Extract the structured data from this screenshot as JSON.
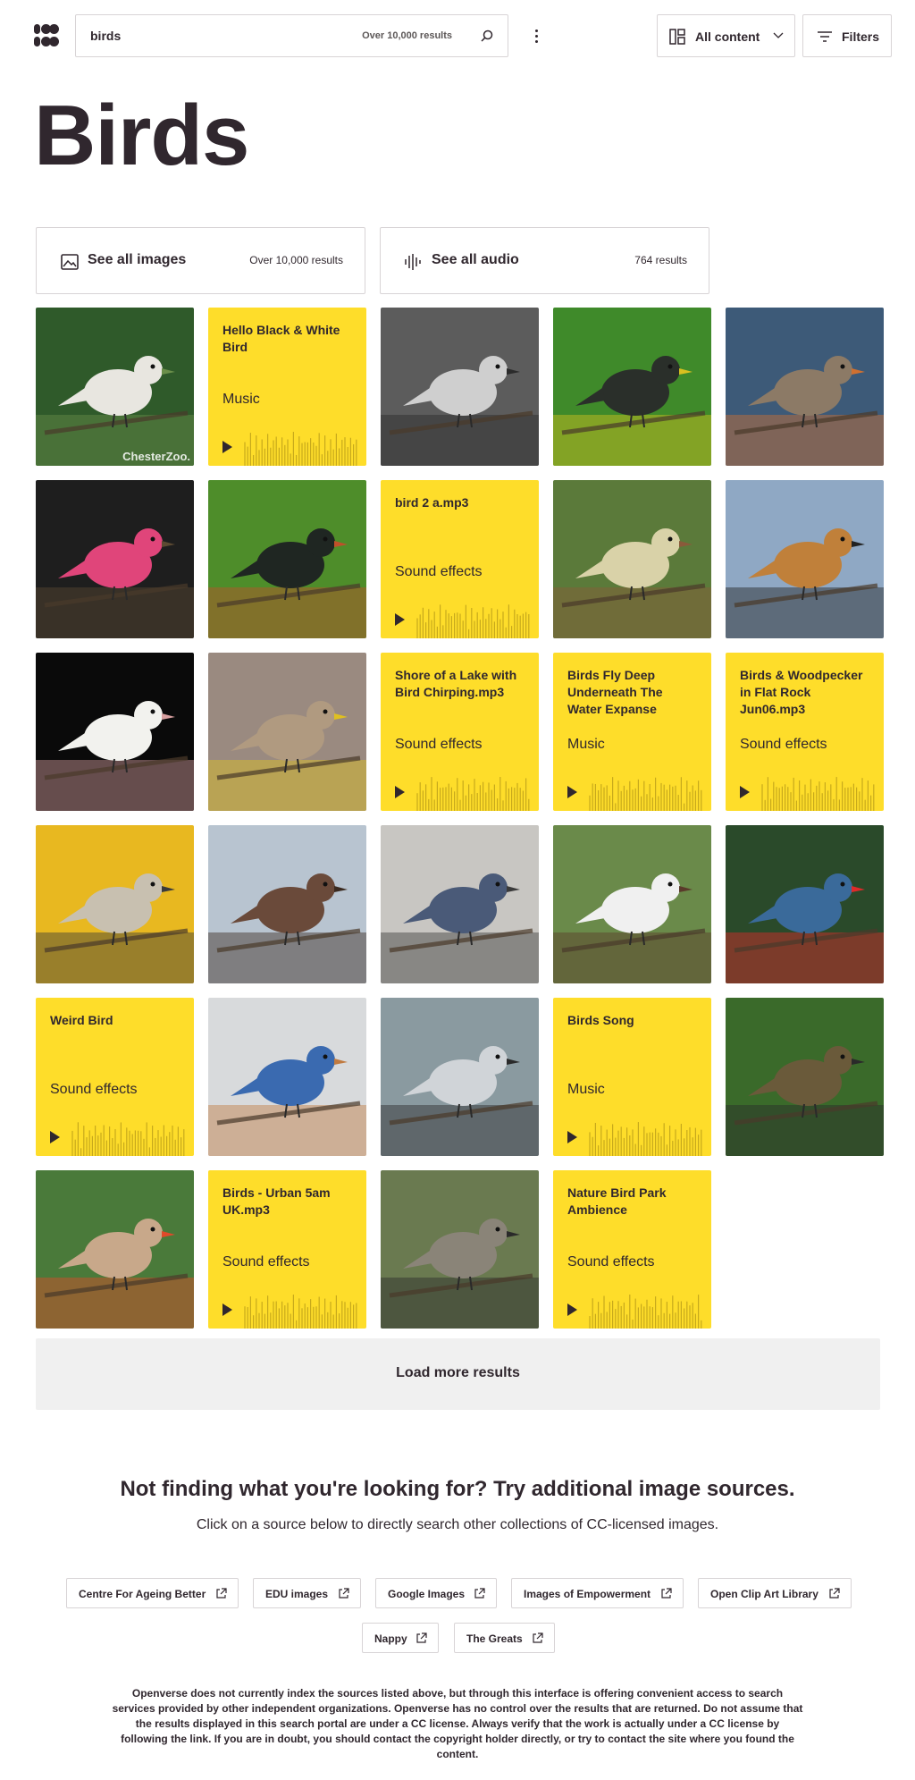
{
  "header": {
    "search_value": "birds",
    "search_count": "Over 10,000 results",
    "content_type_label": "All content",
    "filters_label": "Filters"
  },
  "page_title": "Birds",
  "see_all": [
    {
      "label": "See all images",
      "count": "Over 10,000 results",
      "icon": "image-icon"
    },
    {
      "label": "See all audio",
      "count": "764 results",
      "icon": "audio-wave-icon"
    }
  ],
  "results": [
    {
      "kind": "image",
      "subject": "white pigeon",
      "watermark": "ChesterZoo."
    },
    {
      "kind": "audio",
      "title": "Hello Black & White Bird",
      "category": "Music"
    },
    {
      "kind": "image",
      "subject": "sparrows black and white"
    },
    {
      "kind": "image",
      "subject": "starling on branch"
    },
    {
      "kind": "image",
      "subject": "geese by water"
    },
    {
      "kind": "image",
      "subject": "roseate spoonbill"
    },
    {
      "kind": "image",
      "subject": "starling on green"
    },
    {
      "kind": "audio",
      "title": "bird 2 a.mp3",
      "category": "Sound effects"
    },
    {
      "kind": "image",
      "subject": "warbler in tree"
    },
    {
      "kind": "image",
      "subject": "bird on wire"
    },
    {
      "kind": "image",
      "subject": "cockatiel"
    },
    {
      "kind": "image",
      "subject": "falcon close-up"
    },
    {
      "kind": "audio",
      "title": "Shore of a Lake with Bird Chirping.mp3",
      "category": "Sound effects"
    },
    {
      "kind": "audio",
      "title": "Birds Fly Deep Underneath The Water Expanse",
      "category": "Music"
    },
    {
      "kind": "audio",
      "title": "Birds & Woodpecker in Flat Rock Jun06.mp3",
      "category": "Sound effects"
    },
    {
      "kind": "image",
      "subject": "falcon profile"
    },
    {
      "kind": "image",
      "subject": "robin on branch"
    },
    {
      "kind": "image",
      "subject": "jay on pavement"
    },
    {
      "kind": "image",
      "subject": "flycatcher on branch"
    },
    {
      "kind": "image",
      "subject": "hummingbird with red flowers"
    },
    {
      "kind": "audio",
      "title": "Weird Bird",
      "category": "Sound effects"
    },
    {
      "kind": "image",
      "subject": "bluebird in snow"
    },
    {
      "kind": "image",
      "subject": "mockingbird in branches"
    },
    {
      "kind": "audio",
      "title": "Birds Song",
      "category": "Music"
    },
    {
      "kind": "image",
      "subject": "hermit hummingbird"
    },
    {
      "kind": "image",
      "subject": "finches on branch"
    },
    {
      "kind": "audio",
      "title": "Birds - Urban 5am UK.mp3",
      "category": "Sound effects"
    },
    {
      "kind": "image",
      "subject": "ostrich face"
    },
    {
      "kind": "audio",
      "title": "Nature Bird Park Ambience",
      "category": "Sound effects"
    }
  ],
  "load_more_label": "Load more results",
  "sources": {
    "heading": "Not finding what you're looking for? Try additional image sources.",
    "subheading": "Click on a source below to directly search other collections of CC-licensed images.",
    "buttons": [
      "Centre For Ageing Better",
      "EDU images",
      "Google Images",
      "Images of Empowerment",
      "Open Clip Art Library",
      "Nappy",
      "The Greats"
    ],
    "disclaimer": "Openverse does not currently index the sources listed above, but through this interface is offering convenient access to search services provided by other independent organizations. Openverse has no control over the results that are returned. Do not assume that the results displayed in this search portal are under a CC license. Always verify that the work is actually under a CC license by following the link. If you are in doubt, you should contact the copyright holder directly, or try to contact the site where you found the content."
  },
  "colors": {
    "audio_tile": "#fedd2a",
    "text": "#30272e",
    "border": "#d8d4d6",
    "load_more_bg": "#f0f0f0"
  }
}
